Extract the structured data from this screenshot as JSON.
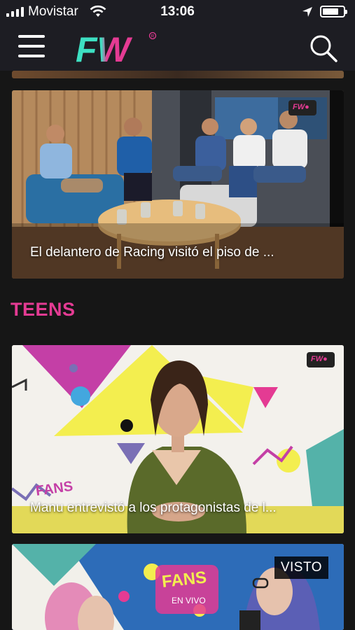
{
  "status_bar": {
    "carrier": "Movistar",
    "time": "13:06"
  },
  "header": {
    "logo_text": "FW",
    "menu_icon": "hamburger-menu-icon",
    "search_icon": "search-icon"
  },
  "colors": {
    "brand_pink": "#e43b93",
    "brand_teal": "#3de0c2",
    "background": "#161616",
    "header_bg": "#1d1d23"
  },
  "feed": {
    "card_1": {
      "caption": "El delantero de Racing visitó el piso de ..."
    },
    "section": {
      "title": "TEENS"
    },
    "card_2": {
      "caption": "Manu entrevistó a los protagonistas de l..."
    },
    "card_3": {
      "badge": "VISTO"
    }
  }
}
